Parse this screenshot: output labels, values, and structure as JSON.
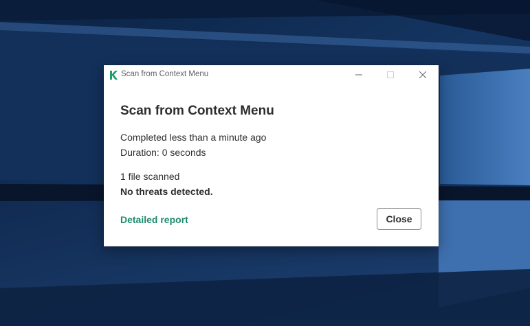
{
  "window": {
    "title": "Scan from Context Menu",
    "controls": {
      "minimize": "minimize-icon",
      "maximize": "maximize-icon",
      "close": "close-icon"
    },
    "logo_icon": "kaspersky-k-logo"
  },
  "dialog": {
    "heading": "Scan from Context Menu",
    "completed": "Completed less than a minute ago",
    "duration": "Duration: 0 seconds",
    "files_scanned": "1 file scanned",
    "result": "No threats detected.",
    "report_link": "Detailed report",
    "close_label": "Close"
  },
  "colors": {
    "accent": "#1e8b6b",
    "desktop": "#0f2a4e"
  }
}
